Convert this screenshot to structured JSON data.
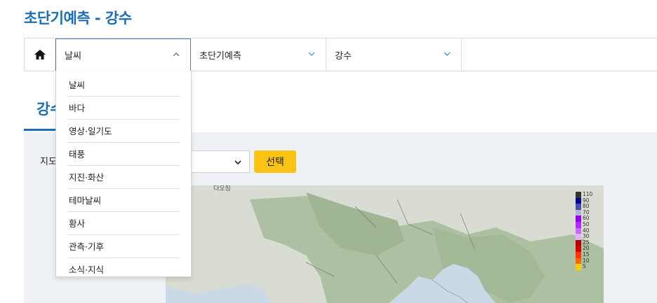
{
  "page": {
    "title": "초단기예측 - 강수"
  },
  "nav": {
    "home_icon": "home-icon",
    "selects": [
      {
        "value": "날씨",
        "state": "open"
      },
      {
        "value": "초단기예측",
        "state": "closed"
      },
      {
        "value": "강수",
        "state": "closed"
      }
    ],
    "dropdown_items": [
      "날씨",
      "바다",
      "영상·일기도",
      "태풍",
      "지진·화산",
      "테마날씨",
      "황사",
      "관측·기후",
      "소식·지식"
    ]
  },
  "section": {
    "tab_label": "강수"
  },
  "controls": {
    "map_label": "지도",
    "select_button": "선택"
  },
  "map": {
    "city_label": "다오징",
    "legend_values": [
      "110",
      "90",
      "80",
      "70",
      "60",
      "50",
      "40",
      "30",
      "25",
      "20",
      "15",
      "10",
      "5"
    ],
    "legend_colors": [
      "#333333",
      "#000390",
      "#4c4eb1",
      "#b3b4de",
      "#9300e4",
      "#b329ff",
      "#c969ff",
      "#e0b4ff",
      "#b40000",
      "#d20000",
      "#ff3300",
      "#ff6600",
      "#ffcc00"
    ]
  },
  "colors": {
    "accent": "#1a6fb8",
    "button": "#f8c313",
    "background": "#eef1f5"
  }
}
